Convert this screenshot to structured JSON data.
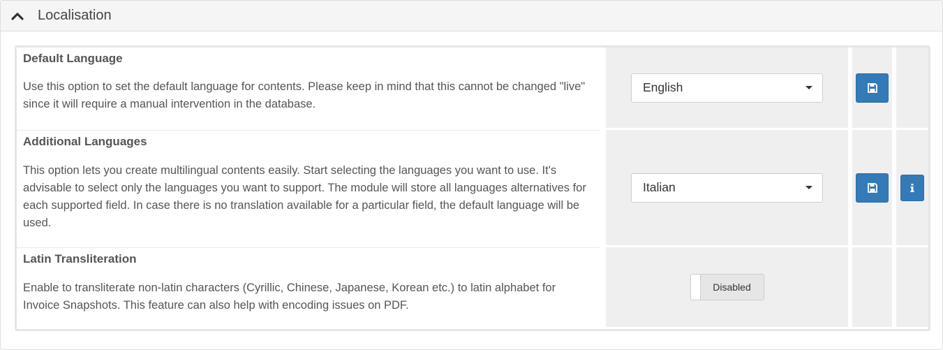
{
  "panel": {
    "title": "Localisation",
    "icon": "chevron-up-icon"
  },
  "settings": [
    {
      "label": "Default Language",
      "description": "Use this option to set the default language for contents. Please keep in mind that this cannot be changed \"live\" since it will require a manual intervention in the database.",
      "control": "select",
      "value": "English",
      "save_icon": "floppy-disk-icon"
    },
    {
      "label": "Additional Languages",
      "description": "This option lets you create multilingual contents easily. Start selecting the languages you want to use. It's advisable to select only the languages you want to support. The module will store all languages alternatives for each supported field. In case there is no translation available for a particular field, the default language will be used.",
      "control": "select",
      "value": "Italian",
      "save_icon": "floppy-disk-icon",
      "info_icon": "info-icon"
    },
    {
      "label": "Latin Transliteration",
      "description": "Enable to transliterate non-latin characters (Cyrillic, Chinese, Japanese, Korean etc.) to latin alphabet for Invoice Snapshots. This feature can also help with encoding issues on PDF.",
      "control": "toggle",
      "value": "Disabled"
    }
  ],
  "colors": {
    "primary": "#337ab7",
    "cell_bg": "#efefef",
    "heading_bg": "#f5f5f5"
  }
}
